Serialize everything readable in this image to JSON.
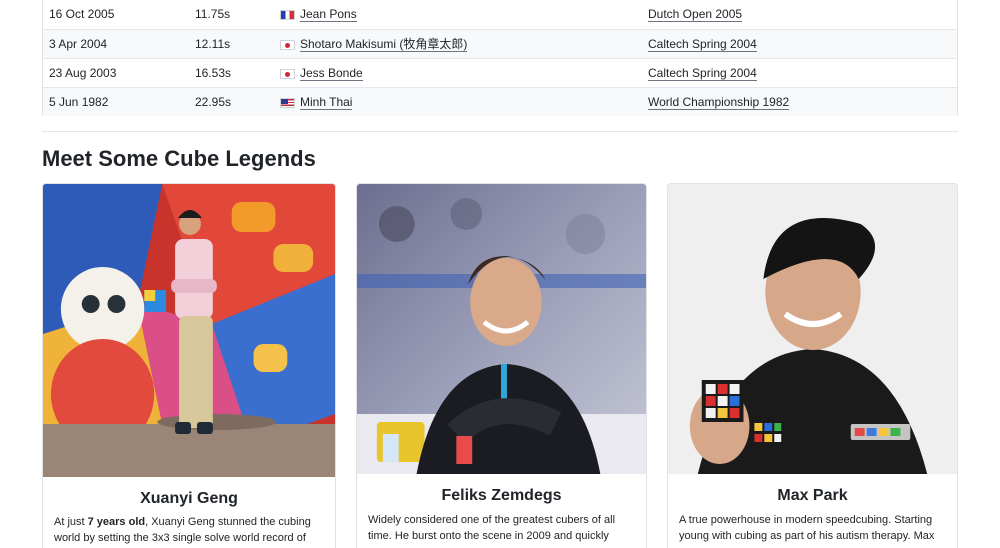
{
  "records": [
    {
      "date": "16 Oct 2005",
      "time": "11.75s",
      "flag": "france-flag-icon",
      "person": "Jean Pons",
      "competition": "Dutch Open 2005"
    },
    {
      "date": "3 Apr 2004",
      "time": "12.11s",
      "flag": "japan-flag-icon",
      "person": "Shotaro Makisumi (牧角章太郎)",
      "competition": "Caltech Spring 2004"
    },
    {
      "date": "23 Aug 2003",
      "time": "16.53s",
      "flag": "japan-flag-icon",
      "person": "Jess Bonde",
      "competition": "Caltech Spring 2004"
    },
    {
      "date": "5 Jun 1982",
      "time": "22.95s",
      "flag": "usa-flag-icon",
      "person": "Minh Thai",
      "competition": "World Championship 1982"
    }
  ],
  "section": {
    "title": "Meet Some Cube Legends"
  },
  "legends": [
    {
      "name": "Xuanyi Geng",
      "intro_pre": "At just ",
      "intro_bold": "7 years old",
      "intro_post": ", Xuanyi Geng stunned the cubing world by setting the 3x3 single solve world record of"
    },
    {
      "name": "Feliks Zemdegs",
      "intro": "Widely considered one of the greatest cubers of all time. He burst onto the scene in 2009 and quickly"
    },
    {
      "name": "Max Park",
      "intro": "A true powerhouse in modern speedcubing. Starting young with cubing as part of his autism therapy. Max"
    }
  ],
  "colors": {
    "text": "#212529",
    "border": "#dee2e6",
    "stripe": "#f8f9fa"
  }
}
